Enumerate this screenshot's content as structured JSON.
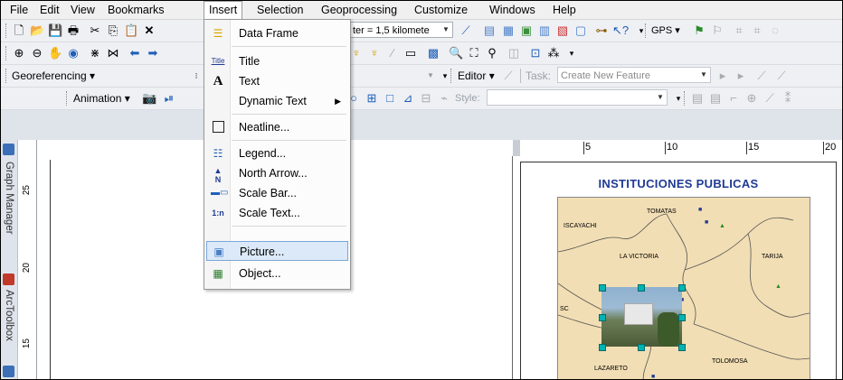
{
  "menubar": {
    "items": [
      "File",
      "Edit",
      "View",
      "Bookmarks",
      "Insert",
      "Selection",
      "Geoprocessing",
      "Customize",
      "Windows",
      "Help"
    ],
    "active": "Insert"
  },
  "toolbar1": {
    "scale_value": "ter = 1,5 kilomete",
    "gps_label": "GPS"
  },
  "toolbar3": {
    "georef_label": "Georeferencing",
    "editor_label": "Editor",
    "task_label": "Task:",
    "task_value": "Create New Feature"
  },
  "toolbar4": {
    "animation_label": "Animation",
    "style_label": "Style:"
  },
  "insert_menu": {
    "items": [
      {
        "label": "Data Frame",
        "icon": "data-frame-icon"
      },
      {
        "label": "Title",
        "icon": "title-icon",
        "icon_text": "Title"
      },
      {
        "label": "Text",
        "icon": "text-icon",
        "icon_text": "A"
      },
      {
        "label": "Dynamic Text",
        "icon": "",
        "submenu": true
      },
      {
        "label": "Neatline...",
        "icon": "neatline-icon"
      },
      {
        "label": "Legend...",
        "icon": "legend-icon"
      },
      {
        "label": "North Arrow...",
        "icon": "north-arrow-icon",
        "icon_text": "N"
      },
      {
        "label": "Scale Bar...",
        "icon": "scale-bar-icon"
      },
      {
        "label": "Scale Text...",
        "icon": "scale-text-icon",
        "icon_text": "1:n"
      },
      {
        "label": "Picture...",
        "icon": "picture-icon",
        "highlighted": true
      },
      {
        "label": "Object...",
        "icon": "object-icon"
      }
    ]
  },
  "side_tabs": {
    "graph_manager": "Graph Manager",
    "arctoolbox": "ArcToolbox"
  },
  "vertical_ruler": [
    "25",
    "20",
    "15"
  ],
  "horizontal_ruler": [
    "5",
    "10",
    "15",
    "20"
  ],
  "layout": {
    "map_title": "INSTITUCIONES PUBLICAS",
    "places": [
      "TOMATAS",
      "ISCAYACHI",
      "LA VICTORIA",
      "TARIJA",
      "TOLOMOSA",
      "LAZARETO",
      "SC"
    ]
  }
}
